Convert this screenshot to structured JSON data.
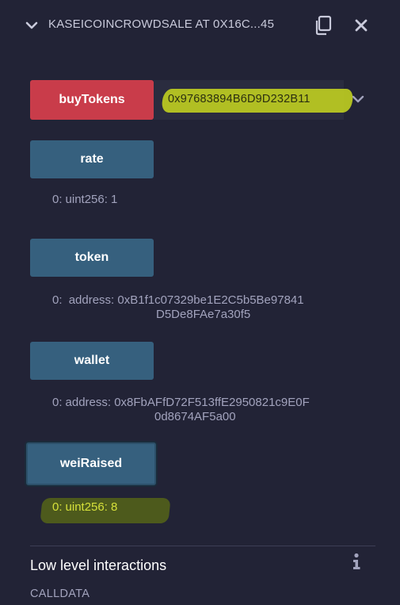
{
  "header": {
    "title": "KASEICOINCROWDSALE AT 0X16C...45",
    "chevron_icon": "chevron-down-icon",
    "copy_icon": "copy-icon",
    "close_icon": "close-icon"
  },
  "functions": {
    "buy_tokens": {
      "label": "buyTokens",
      "argument_value": "0x97683894B6D9D232B11",
      "color": "#c93c4a"
    },
    "rate": {
      "label": "rate",
      "output_index": "0:",
      "output_value": "uint256: 1"
    },
    "token": {
      "label": "token",
      "output_index": "0:",
      "output_line1": "address: 0xB1f1c07329be1E2C5b5Be97841",
      "output_line2": "D5De8FAe7a30f5"
    },
    "wallet": {
      "label": "wallet",
      "output_index": "0:",
      "output_line1": "address: 0x8FbAFfD72F513ffE2950821c9E0F",
      "output_line2": "0d8674AF5a00"
    },
    "wei_raised": {
      "label": "weiRaised",
      "output_index": "0:",
      "output_value": "uint256: 8"
    }
  },
  "low_level": {
    "title": "Low level interactions",
    "info_icon": "info-icon",
    "calldata_label": "CALLDATA"
  },
  "colors": {
    "background": "#222336",
    "call_button": "#36607e",
    "transact_button": "#c93c4a",
    "highlight": "#c9d91e"
  }
}
